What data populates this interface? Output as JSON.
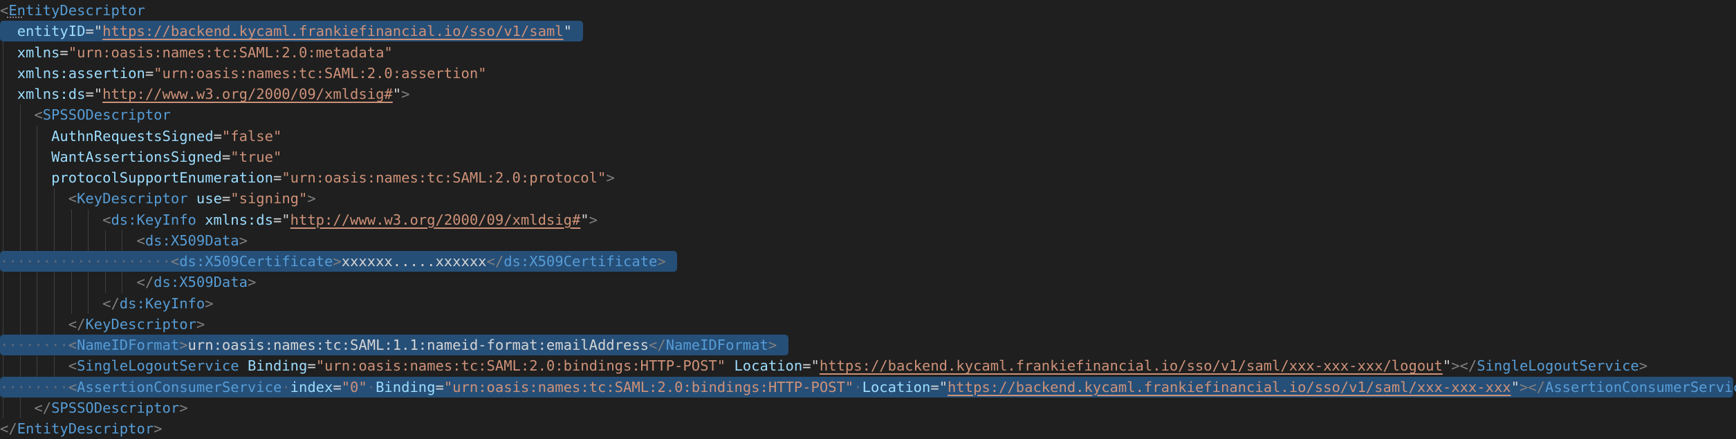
{
  "editor": {
    "background": "#1f1f1f",
    "selection_color": "#264f78",
    "language": "xml",
    "lines": [
      [
        [
          "bracket",
          "<"
        ],
        [
          "tag",
          "EntityDescriptor"
        ]
      ],
      [
        [
          "text",
          "  "
        ],
        [
          "attr",
          "entityID"
        ],
        [
          "eq",
          "=\""
        ],
        [
          "url",
          "https://backend.kycaml.frankiefinancial.io/sso/v1/saml"
        ],
        [
          "eq",
          "\""
        ],
        [
          "text",
          " "
        ]
      ],
      [
        [
          "text",
          "  "
        ],
        [
          "attr",
          "xmlns"
        ],
        [
          "eq",
          "="
        ],
        [
          "str",
          "\"urn:oasis:names:tc:SAML:2.0:metadata\""
        ]
      ],
      [
        [
          "text",
          "  "
        ],
        [
          "attr",
          "xmlns:assertion"
        ],
        [
          "eq",
          "="
        ],
        [
          "str",
          "\"urn:oasis:names:tc:SAML:2.0:assertion\""
        ]
      ],
      [
        [
          "text",
          "  "
        ],
        [
          "attr",
          "xmlns:ds"
        ],
        [
          "eq",
          "=\""
        ],
        [
          "url",
          "http://www.w3.org/2000/09/xmldsig#"
        ],
        [
          "eq",
          "\""
        ],
        [
          "bracket",
          ">"
        ]
      ],
      [
        [
          "text",
          "    "
        ],
        [
          "bracket",
          "<"
        ],
        [
          "tag",
          "SPSSODescriptor"
        ]
      ],
      [
        [
          "text",
          "      "
        ],
        [
          "attr",
          "AuthnRequestsSigned"
        ],
        [
          "eq",
          "="
        ],
        [
          "str",
          "\"false\""
        ]
      ],
      [
        [
          "text",
          "      "
        ],
        [
          "attr",
          "WantAssertionsSigned"
        ],
        [
          "eq",
          "="
        ],
        [
          "str",
          "\"true\""
        ]
      ],
      [
        [
          "text",
          "      "
        ],
        [
          "attr",
          "protocolSupportEnumeration"
        ],
        [
          "eq",
          "="
        ],
        [
          "str",
          "\"urn:oasis:names:tc:SAML:2.0:protocol\""
        ],
        [
          "bracket",
          ">"
        ]
      ],
      [
        [
          "text",
          "        "
        ],
        [
          "bracket",
          "<"
        ],
        [
          "tag",
          "KeyDescriptor"
        ],
        [
          "text",
          " "
        ],
        [
          "attr",
          "use"
        ],
        [
          "eq",
          "="
        ],
        [
          "str",
          "\"signing\""
        ],
        [
          "bracket",
          ">"
        ]
      ],
      [
        [
          "text",
          "            "
        ],
        [
          "bracket",
          "<"
        ],
        [
          "tag",
          "ds:KeyInfo"
        ],
        [
          "text",
          " "
        ],
        [
          "attr",
          "xmlns:ds"
        ],
        [
          "eq",
          "=\""
        ],
        [
          "url",
          "http://www.w3.org/2000/09/xmldsig#"
        ],
        [
          "eq",
          "\""
        ],
        [
          "bracket",
          ">"
        ]
      ],
      [
        [
          "text",
          "                "
        ],
        [
          "bracket",
          "<"
        ],
        [
          "tag",
          "ds:X509Data"
        ],
        [
          "bracket",
          ">"
        ]
      ],
      [
        [
          "ws",
          "····················"
        ],
        [
          "bracket",
          "<"
        ],
        [
          "tag",
          "ds:X509Certificate"
        ],
        [
          "bracket",
          ">"
        ],
        [
          "text",
          "xxxxxx.....xxxxxx"
        ],
        [
          "bracket",
          "</"
        ],
        [
          "tag",
          "ds:X509Certificate"
        ],
        [
          "bracket",
          ">"
        ],
        [
          "text",
          " "
        ]
      ],
      [
        [
          "text",
          "                "
        ],
        [
          "bracket",
          "</"
        ],
        [
          "tag",
          "ds:X509Data"
        ],
        [
          "bracket",
          ">"
        ]
      ],
      [
        [
          "text",
          "            "
        ],
        [
          "bracket",
          "</"
        ],
        [
          "tag",
          "ds:KeyInfo"
        ],
        [
          "bracket",
          ">"
        ]
      ],
      [
        [
          "text",
          "        "
        ],
        [
          "bracket",
          "</"
        ],
        [
          "tag",
          "KeyDescriptor"
        ],
        [
          "bracket",
          ">"
        ]
      ],
      [
        [
          "ws",
          "········"
        ],
        [
          "bracket",
          "<"
        ],
        [
          "tag",
          "NameIDFormat"
        ],
        [
          "bracket",
          ">"
        ],
        [
          "text",
          "urn:oasis:names:tc:SAML:1.1:nameid-format:emailAddress"
        ],
        [
          "bracket",
          "</"
        ],
        [
          "tag",
          "NameIDFormat"
        ],
        [
          "bracket",
          ">"
        ],
        [
          "text",
          " "
        ]
      ],
      [
        [
          "text",
          "        "
        ],
        [
          "bracket",
          "<"
        ],
        [
          "tag",
          "SingleLogoutService"
        ],
        [
          "text",
          " "
        ],
        [
          "attr",
          "Binding"
        ],
        [
          "eq",
          "="
        ],
        [
          "str",
          "\"urn:oasis:names:tc:SAML:2.0:bindings:HTTP-POST\""
        ],
        [
          "text",
          " "
        ],
        [
          "attr",
          "Location"
        ],
        [
          "eq",
          "=\""
        ],
        [
          "url",
          "https://backend.kycaml.frankiefinancial.io/sso/v1/saml/xxx-xxx-xxx/logout"
        ],
        [
          "eq",
          "\""
        ],
        [
          "bracket",
          "></"
        ],
        [
          "tag",
          "SingleLogoutService"
        ],
        [
          "bracket",
          ">"
        ]
      ],
      [
        [
          "ws",
          "········"
        ],
        [
          "bracket",
          "<"
        ],
        [
          "tag",
          "AssertionConsumerService"
        ],
        [
          "ws",
          "·"
        ],
        [
          "attr",
          "index"
        ],
        [
          "eq",
          "="
        ],
        [
          "str",
          "\"0\""
        ],
        [
          "ws",
          "·"
        ],
        [
          "attr",
          "Binding"
        ],
        [
          "eq",
          "="
        ],
        [
          "str",
          "\"urn:oasis:names:tc:SAML:2.0:bindings:HTTP-POST\""
        ],
        [
          "ws",
          "·"
        ],
        [
          "attr",
          "Location"
        ],
        [
          "eq",
          "=\""
        ],
        [
          "url",
          "https://backend.kycaml.frankiefinancial.io/sso/v1/saml/xxx-xxx-xxx"
        ],
        [
          "eq",
          "\""
        ],
        [
          "bracket",
          "></"
        ],
        [
          "tag",
          "AssertionConsumerService"
        ],
        [
          "bracket",
          ">"
        ],
        [
          "text",
          " "
        ]
      ],
      [
        [
          "text",
          "    "
        ],
        [
          "bracket",
          "</"
        ],
        [
          "tag",
          "SPSSODescriptor"
        ],
        [
          "bracket",
          ">"
        ]
      ],
      [
        [
          "bracket",
          "</"
        ],
        [
          "tag",
          "EntityDescriptor"
        ],
        [
          "bracket",
          ">"
        ]
      ]
    ],
    "highlighted_rows": [
      1,
      12,
      16,
      18
    ]
  }
}
